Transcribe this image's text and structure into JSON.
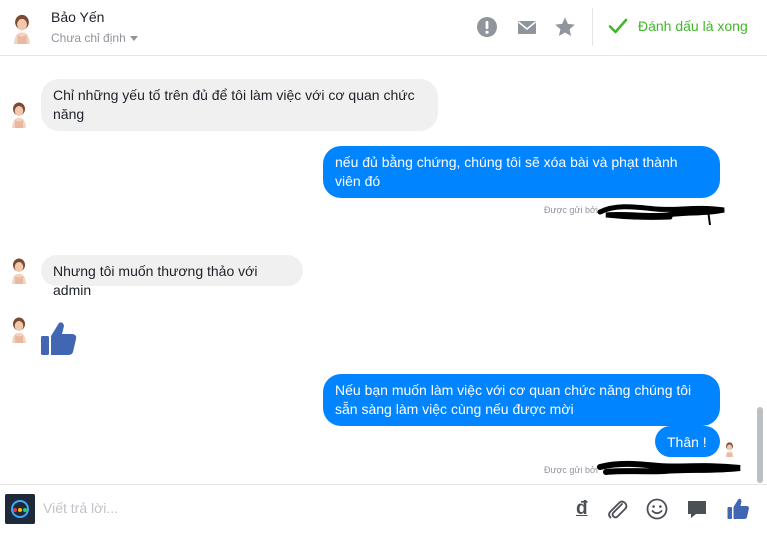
{
  "header": {
    "contact_name": "Bảo Yến",
    "assignee": "Chưa chỉ định",
    "icons": [
      "alert-icon",
      "envelope-icon",
      "star-icon"
    ],
    "done_label": "Đánh dấu là xong"
  },
  "messages": [
    {
      "from": "contact",
      "text_line1": "Chỉ những yếu tố trên đủ để tôi làm việc với cơ quan chức",
      "text_line2": "năng"
    },
    {
      "from": "page",
      "text_line1": "nếu đủ bằng chứng, chúng tôi sẽ xóa bài và phạt thành",
      "text_line2": "viên đó",
      "sent_by": "Được gửi bởi"
    },
    {
      "from": "contact",
      "text": "Nhưng tôi muốn thương thảo với admin"
    },
    {
      "from": "contact",
      "type": "like-sticker"
    },
    {
      "from": "page",
      "text_line1": "Nếu bạn muốn làm việc với cơ quan chức năng chúng tôi",
      "text_line2": "sẵn sàng làm việc cùng nếu được mời"
    },
    {
      "from": "page",
      "text": "Thân !",
      "sent_by": "Được gửi bởi"
    }
  ],
  "composer": {
    "placeholder": "Viết trả lời...",
    "currency_symbol": "đ",
    "icons": [
      "attachment-icon",
      "emoji-icon",
      "sticker-icon",
      "like-icon"
    ]
  },
  "colors": {
    "accent": "#0084ff",
    "incoming_bubble": "#f1f0f0",
    "done_green": "#42b72a",
    "muted_text": "#90949c"
  }
}
